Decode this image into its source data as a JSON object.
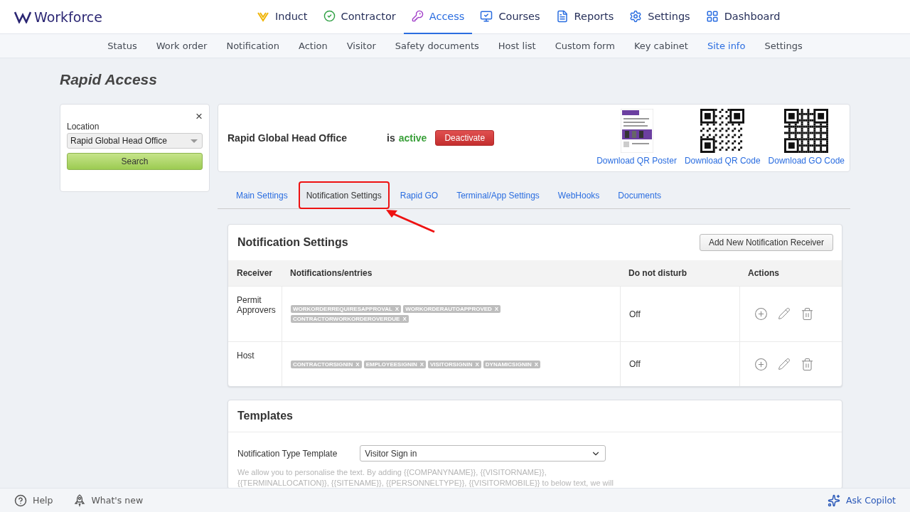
{
  "brand": {
    "name": "Workforce"
  },
  "main_nav": [
    {
      "label": "Induct",
      "selected": false
    },
    {
      "label": "Contractor",
      "selected": false
    },
    {
      "label": "Access",
      "selected": true
    },
    {
      "label": "Courses",
      "selected": false
    },
    {
      "label": "Reports",
      "selected": false
    },
    {
      "label": "Settings",
      "selected": false
    },
    {
      "label": "Dashboard",
      "selected": false
    }
  ],
  "sub_nav": [
    {
      "label": "Status",
      "selected": false
    },
    {
      "label": "Work order",
      "selected": false
    },
    {
      "label": "Notification",
      "selected": false
    },
    {
      "label": "Action",
      "selected": false
    },
    {
      "label": "Visitor",
      "selected": false
    },
    {
      "label": "Safety documents",
      "selected": false
    },
    {
      "label": "Host list",
      "selected": false
    },
    {
      "label": "Custom form",
      "selected": false
    },
    {
      "label": "Key cabinet",
      "selected": false
    },
    {
      "label": "Site info",
      "selected": true
    },
    {
      "label": "Settings",
      "selected": false
    }
  ],
  "page_title": "Rapid Access",
  "location_panel": {
    "close": "×",
    "label": "Location",
    "value": "Rapid Global Head Office",
    "search_button": "Search"
  },
  "site": {
    "name": "Rapid Global Head Office",
    "status_prefix": "is",
    "status": "active",
    "active": true,
    "deactivate_button": "Deactivate",
    "downloads": [
      {
        "kind": "poster",
        "label": "Download QR Poster"
      },
      {
        "kind": "qr",
        "label": "Download QR Code"
      },
      {
        "kind": "qr",
        "label": "Download GO Code"
      }
    ]
  },
  "tabs": [
    {
      "label": "Main Settings",
      "selected": false,
      "highlighted": false
    },
    {
      "label": "Notification Settings",
      "selected": true,
      "highlighted": true
    },
    {
      "label": "Rapid GO",
      "selected": false,
      "highlighted": false
    },
    {
      "label": "Terminal/App Settings",
      "selected": false,
      "highlighted": false
    },
    {
      "label": "WebHooks",
      "selected": false,
      "highlighted": false
    },
    {
      "label": "Documents",
      "selected": false,
      "highlighted": false
    }
  ],
  "notification_settings": {
    "title": "Notification Settings",
    "add_button": "Add New Notification Receiver",
    "columns": [
      "Receiver",
      "Notifications/entries",
      "Do not disturb",
      "Actions"
    ],
    "rows": [
      {
        "receiver": "Permit Approvers",
        "entries": [
          {
            "label": "WORKORDERREQUIRESAPPROVAL",
            "remove": "X"
          },
          {
            "label": "WORKORDERAUTOAPPROVED",
            "remove": "X"
          },
          {
            "label": "CONTRACTORWORKORDEROVERDUE",
            "remove": "X"
          }
        ],
        "do_not_disturb": "Off"
      },
      {
        "receiver": "Host",
        "entries": [
          {
            "label": "CONTRACTORSIGNIN",
            "remove": "X"
          },
          {
            "label": "EMPLOYEESIGNIN",
            "remove": "X"
          },
          {
            "label": "VISITORSIGNIN",
            "remove": "X"
          },
          {
            "label": "DYNAMICSIGNIN",
            "remove": "X"
          }
        ],
        "do_not_disturb": "Off"
      }
    ]
  },
  "templates": {
    "title": "Templates",
    "field_label": "Notification Type Template",
    "value": "Visitor Sign in",
    "help_text": "We allow you to personalise the text. By adding {{COMPANYNAME}}, {{VISITORNAME}}, {{TERMINALLOCATION}}, {{SITENAME}}, {{PERSONNELTYPE}}, {{VISITORMOBILE}} to below text, we will"
  },
  "footer": {
    "help": "Help",
    "whats_new": "What's new",
    "copilot": "Ask Copilot"
  }
}
